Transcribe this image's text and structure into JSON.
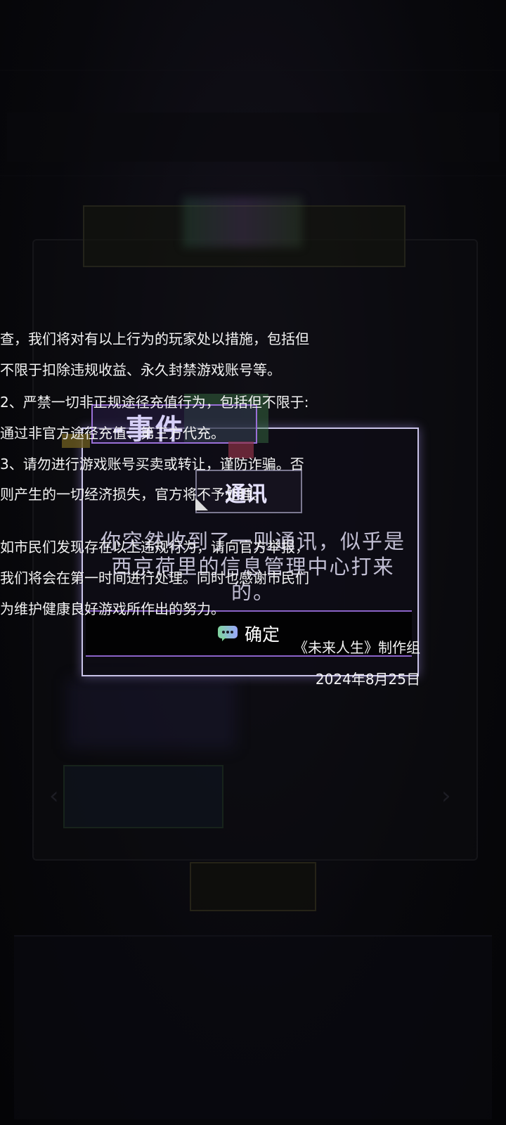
{
  "notice": {
    "lines": [
      "查，我们将对有以上行为的玩家处以措施，包括但",
      "不限于扣除违规收益、永久封禁游戏账号等。",
      "2、严禁一切非正规途径充值行为，包括但不限于:",
      "通过非官方途径充值、第三方代充。",
      "3、请勿进行游戏账号买卖或转让，谨防诈骗。否",
      "则产生的一切经济损失，官方将不予处理。"
    ],
    "report_lines": [
      "如市民们发现存在以上违规行为，请向官方举报，",
      "我们将会在第一时间进行处理。同时也感谢市民们",
      "为维护健康良好游戏所作出的努力。"
    ],
    "signature": "《未来人生》制作组",
    "date": "2024年8月25日"
  },
  "event_popup": {
    "tag_title": "-事件",
    "subtitle": "通讯",
    "description": "你突然收到了一则通讯，似乎是西京荷里的信息管理中心打来的。",
    "confirm_label": "确定"
  },
  "colors": {
    "popup_border": "#c9c3e8",
    "accent_purple": "#8a63c8"
  }
}
